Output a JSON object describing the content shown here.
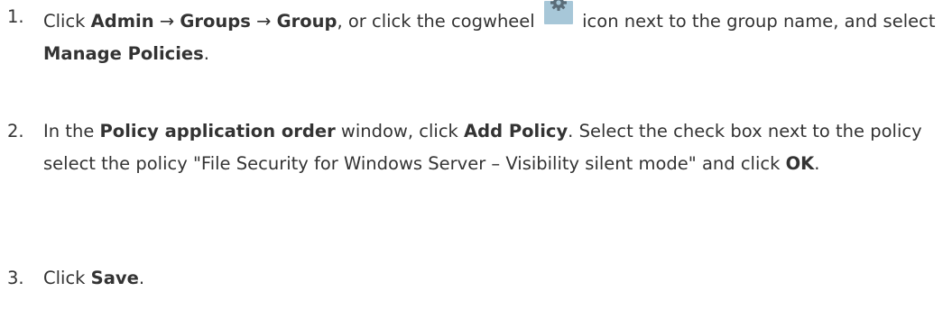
{
  "steps": [
    {
      "number": "1.",
      "parts": {
        "t1": "Click ",
        "b1": "Admin",
        "t2": " → ",
        "b2": "Groups",
        "t3": " → ",
        "b3": "Group",
        "t4": ", or click the cogwheel ",
        "icon": "cogwheel-icon",
        "t5": " icon next to the group name, and select ",
        "b4": "Manage Policies",
        "t6": "."
      }
    },
    {
      "number": "2.",
      "parts": {
        "t1": "In the ",
        "b1": "Policy application order",
        "t2": " window, click ",
        "b2": "Add Policy",
        "t3": ". Select the check box next to the policy select the policy \"File Security for Windows Server – Visibility silent mode\" and click ",
        "b3": "OK",
        "t4": "."
      }
    },
    {
      "number": "3.",
      "parts": {
        "t1": "Click ",
        "b1": "Save",
        "t2": "."
      }
    }
  ],
  "colors": {
    "text": "#333333",
    "icon_background": "#a7c7d8",
    "icon_glyph": "#5a6c78"
  }
}
